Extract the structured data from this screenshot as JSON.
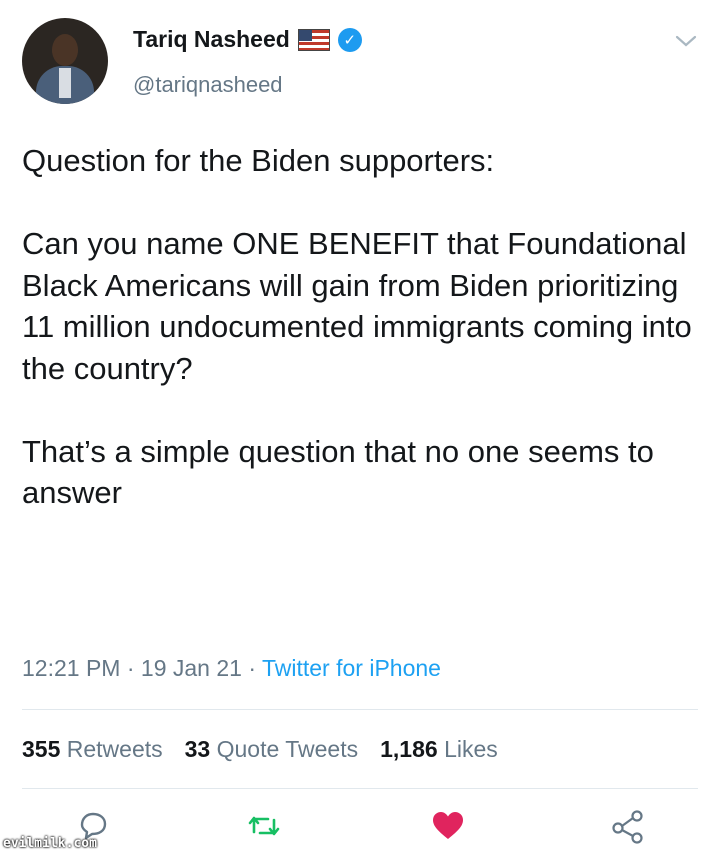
{
  "author": {
    "name": "Tariq Nasheed",
    "handle": "@tariqnasheed",
    "flag_icon": "us-flag-icon",
    "verified_icon": "verified-badge-icon"
  },
  "tweet": {
    "paragraphs": [
      "Question for the Biden supporters:",
      "Can you name ONE BENEFIT that Foundational Black Americans will gain from Biden prioritizing 11 million undocumented immigrants coming into the country?",
      "That’s a simple question that no one seems to answer"
    ],
    "time": "12:21 PM",
    "date": "19 Jan 21",
    "source": "Twitter for iPhone",
    "separator": "·"
  },
  "stats": {
    "retweets_count": "355",
    "retweets_label": "Retweets",
    "quotes_count": "33",
    "quotes_label": "Quote Tweets",
    "likes_count": "1,186",
    "likes_label": "Likes"
  },
  "actions": {
    "reply_icon": "reply-icon",
    "retweet_icon": "retweet-icon",
    "like_icon": "heart-icon",
    "share_icon": "share-icon"
  },
  "colors": {
    "accent": "#1da1f2",
    "retweet": "#17bf63",
    "like": "#e0245e",
    "muted": "#657786"
  },
  "watermark": "evilmilk.com"
}
